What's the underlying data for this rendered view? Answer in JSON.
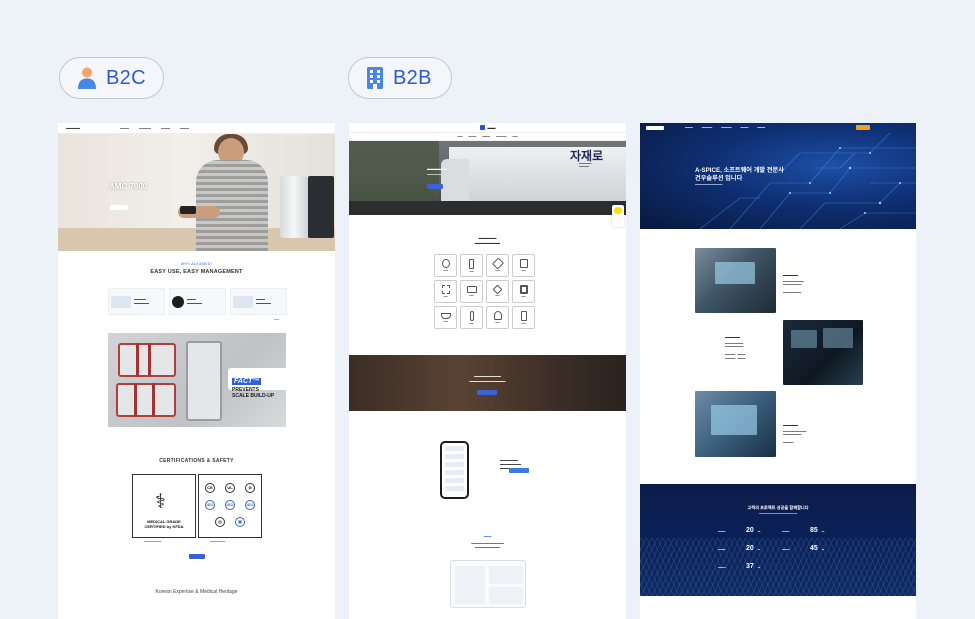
{
  "labels": {
    "b2c": "B2C",
    "b2b": "B2B"
  },
  "icons": {
    "b2c": "person-icon",
    "b2b": "building-icon"
  },
  "colors": {
    "accent": "#2d5bd8",
    "background": "#edf1f8"
  },
  "card1": {
    "hero_title": "AMC 7000",
    "subtitle": "WHY ALKAMEDI",
    "headline": "EASY USE, EASY MANAGEMENT",
    "fact_word": "FACT™",
    "fact_line1": "PREVENTS",
    "fact_line2": "SCALE BUILD-UP",
    "cert_title": "CERTIFICATIONS & SAFETY",
    "medical_line1": "MEDICAL GRADE",
    "medical_line2": "CERTIFIED by KFDA",
    "cert_logos": [
      "CE",
      "UL",
      "ISO",
      "ISO",
      "ISO"
    ],
    "footer": "Korean Expertise & Medical Heritage"
  },
  "card2": {
    "brand_big": "자재로"
  },
  "card3": {
    "hero_line1": "A-SPICE, 소프트웨어 개발 전문사",
    "hero_line2": "건우솔루션 입니다",
    "stats_title": "고객의 프로젝트 성공을 함께합니다",
    "stats": [
      {
        "value": "20"
      },
      {
        "value": "85"
      },
      {
        "value": "20"
      },
      {
        "value": "45"
      },
      {
        "value": "37"
      }
    ]
  }
}
